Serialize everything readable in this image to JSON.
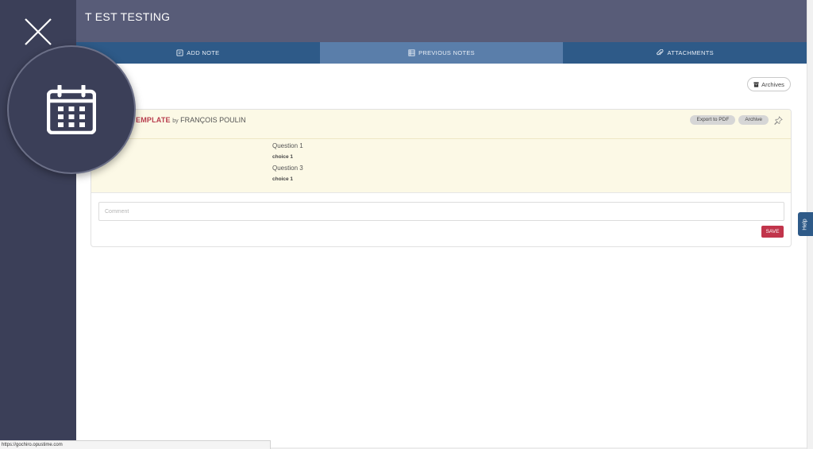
{
  "page": {
    "title": "T EST TESTING"
  },
  "tabs": [
    {
      "label": "ADD NOTE",
      "icon": "edit-note-icon",
      "active": false
    },
    {
      "label": "PREVIOUS NOTES",
      "icon": "list-icon",
      "active": true
    },
    {
      "label": "ATTACHMENTS",
      "icon": "paperclip-icon",
      "active": false
    }
  ],
  "archives_button": {
    "label": "Archives",
    "icon": "archive-box-icon"
  },
  "note": {
    "template": "EMPLATE",
    "by": "by",
    "author": "FRANÇOIS POULIN",
    "export_label": "Export to PDF",
    "archive_label": "Archive",
    "items": [
      {
        "question": "Question 1",
        "answer": "choice 1"
      },
      {
        "question": "Question 3",
        "answer": "choice 1"
      }
    ]
  },
  "comment": {
    "placeholder": "Comment",
    "save_label": "SAVE"
  },
  "help": {
    "label": "Help"
  },
  "status_bar": {
    "url": "https://gochiro.opustime.com"
  },
  "colors": {
    "sidebar": "#3b3f58",
    "topbar": "#585c78",
    "tabs": "#2e5a88",
    "tab_active": "#5a7eaa",
    "accent": "#c1344b",
    "note_bg": "#fcf9e6"
  }
}
